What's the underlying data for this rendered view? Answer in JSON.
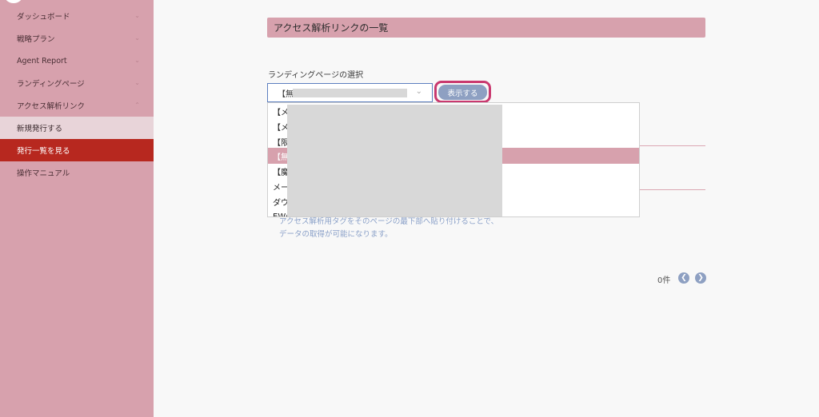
{
  "sidebar": {
    "items": [
      {
        "label": "ダッシュボード",
        "chevron": "⌄"
      },
      {
        "label": "戦略プラン",
        "chevron": "⌄"
      },
      {
        "label": "Agent Report",
        "chevron": "⌄"
      },
      {
        "label": "ランディングページ",
        "chevron": "⌄"
      },
      {
        "label": "アクセス解析リンク",
        "chevron": "⌃"
      },
      {
        "label": "新規発行する"
      },
      {
        "label": "発行一覧を見る"
      },
      {
        "label": "操作マニュアル"
      }
    ]
  },
  "main": {
    "title": "アクセス解析リンクの一覧",
    "select_label": "ランディングページの選択",
    "select_value": "【無料",
    "select_chevron": "⌄",
    "show_button": "表示する",
    "help_line1": "アクセス解析用タグをそのページの最下部へ貼り付けることで、",
    "help_line2": "データの取得が可能になります。",
    "count": "0件",
    "prev": "❮",
    "next": "❯"
  },
  "dropdown": {
    "options": [
      {
        "text": "【メ",
        "highlighted": false
      },
      {
        "text": "【メ",
        "highlighted": false
      },
      {
        "text": "【限",
        "highlighted": false
      },
      {
        "text": "【無",
        "highlighted": true
      },
      {
        "text": "【魔",
        "highlighted": false
      },
      {
        "text": "メー",
        "highlighted": false
      },
      {
        "text": "ダウ",
        "highlighted": false
      },
      {
        "text": "EWA",
        "highlighted": false
      }
    ]
  },
  "colors": {
    "sidebar_bg": "#d7a1ad",
    "active_item": "#b7281f",
    "button": "#8ea0c2",
    "focus_ring": "#c9396f"
  }
}
